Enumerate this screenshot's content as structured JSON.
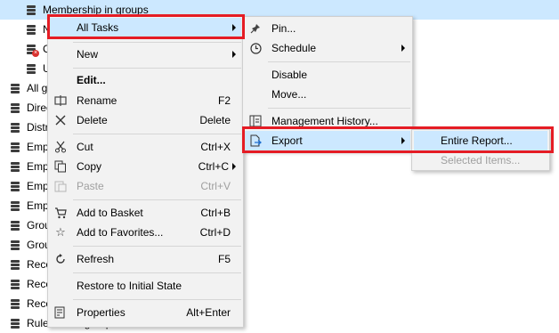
{
  "tree": [
    {
      "label": "Membership in groups",
      "selected": true
    },
    {
      "label": "N",
      "selected": false
    },
    {
      "label": "C",
      "selected": false,
      "error": true
    },
    {
      "label": "U",
      "selected": false
    },
    {
      "label": "All grou",
      "selected": false
    },
    {
      "label": "Direc",
      "selected": false
    },
    {
      "label": "Distri",
      "selected": false
    },
    {
      "label": "Empt",
      "selected": false
    },
    {
      "label": "Empt",
      "selected": false
    },
    {
      "label": "Empt",
      "selected": false
    },
    {
      "label": "Empt",
      "selected": false
    },
    {
      "label": "Group",
      "selected": false
    },
    {
      "label": "Group",
      "selected": false
    },
    {
      "label": "Rece",
      "selected": false
    },
    {
      "label": "Rece",
      "selected": false
    },
    {
      "label": "Rece",
      "selected": false
    },
    {
      "label": "Rule-based groups",
      "selected": false
    }
  ],
  "context_menu": {
    "all_tasks": "All Tasks",
    "new": "New",
    "edit": "Edit...",
    "rename": "Rename",
    "rename_shortcut": "F2",
    "delete": "Delete",
    "delete_shortcut": "Delete",
    "cut": "Cut",
    "cut_shortcut": "Ctrl+X",
    "copy": "Copy",
    "copy_shortcut": "Ctrl+C",
    "paste": "Paste",
    "paste_shortcut": "Ctrl+V",
    "add_to_basket": "Add to Basket",
    "add_to_basket_shortcut": "Ctrl+B",
    "add_to_favorites": "Add to Favorites...",
    "add_to_favorites_shortcut": "Ctrl+D",
    "refresh": "Refresh",
    "refresh_shortcut": "F5",
    "restore": "Restore to Initial State",
    "properties": "Properties",
    "properties_shortcut": "Alt+Enter"
  },
  "tasks_menu": {
    "pin": "Pin...",
    "schedule": "Schedule",
    "disable": "Disable",
    "move": "Move...",
    "management_history": "Management History...",
    "export": "Export"
  },
  "export_menu": {
    "entire_report": "Entire Report...",
    "selected_items": "Selected Items..."
  },
  "colors": {
    "highlight": "#cce8ff",
    "menu_bg": "#f2f2f2",
    "annotation_red": "#e51c24"
  }
}
